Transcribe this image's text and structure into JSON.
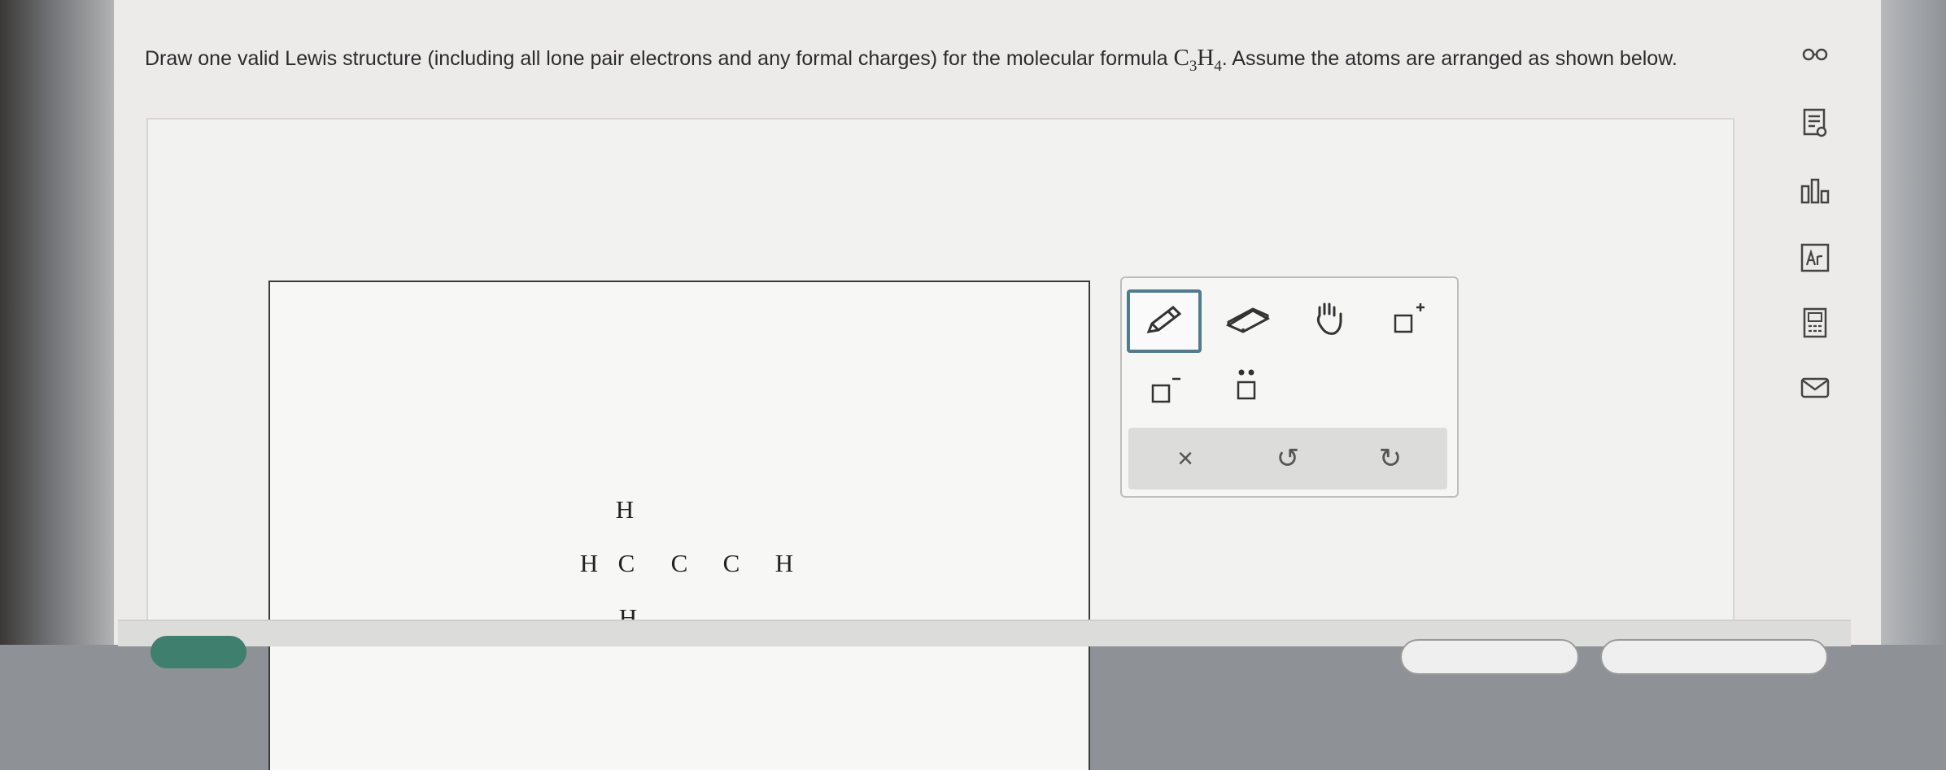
{
  "question": {
    "text_before": "Draw one valid Lewis structure (including all lone pair electrons and any formal charges) for the molecular formula ",
    "formula_c": "C",
    "formula_c_sub": "3",
    "formula_h": "H",
    "formula_h_sub": "4",
    "text_after": ". Assume the atoms are arranged as shown below."
  },
  "atoms": {
    "top_h": "H",
    "left_h": "H",
    "c1": "C",
    "c2": "C",
    "c3": "C",
    "right_h": "H",
    "bottom_h": "H"
  },
  "toolbox": {
    "tools": [
      "pencil-icon",
      "eraser-icon",
      "hand-icon",
      "positive-charge-icon",
      "negative-charge-icon",
      "lone-pair-icon"
    ],
    "active_tool": "pencil-icon",
    "actions": {
      "clear": "×",
      "undo": "↺",
      "redo": "↻"
    }
  },
  "sidebar": {
    "icons": [
      "glasses-icon",
      "notes-icon",
      "chart-icon",
      "periodic-table-icon",
      "calculator-icon",
      "mail-icon"
    ]
  },
  "colors": {
    "accent": "#4f7c8f",
    "button_green": "#3f7f6e"
  }
}
